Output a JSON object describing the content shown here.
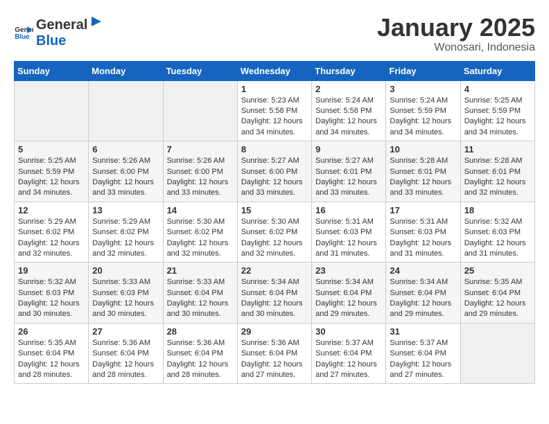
{
  "header": {
    "logo_general": "General",
    "logo_blue": "Blue",
    "month_title": "January 2025",
    "location": "Wonosari, Indonesia"
  },
  "weekdays": [
    "Sunday",
    "Monday",
    "Tuesday",
    "Wednesday",
    "Thursday",
    "Friday",
    "Saturday"
  ],
  "weeks": [
    [
      {
        "day": "",
        "empty": true
      },
      {
        "day": "",
        "empty": true
      },
      {
        "day": "",
        "empty": true
      },
      {
        "day": "1",
        "sunrise": "5:23 AM",
        "sunset": "5:58 PM",
        "daylight": "12 hours and 34 minutes."
      },
      {
        "day": "2",
        "sunrise": "5:24 AM",
        "sunset": "5:58 PM",
        "daylight": "12 hours and 34 minutes."
      },
      {
        "day": "3",
        "sunrise": "5:24 AM",
        "sunset": "5:59 PM",
        "daylight": "12 hours and 34 minutes."
      },
      {
        "day": "4",
        "sunrise": "5:25 AM",
        "sunset": "5:59 PM",
        "daylight": "12 hours and 34 minutes."
      }
    ],
    [
      {
        "day": "5",
        "sunrise": "5:25 AM",
        "sunset": "5:59 PM",
        "daylight": "12 hours and 34 minutes."
      },
      {
        "day": "6",
        "sunrise": "5:26 AM",
        "sunset": "6:00 PM",
        "daylight": "12 hours and 33 minutes."
      },
      {
        "day": "7",
        "sunrise": "5:26 AM",
        "sunset": "6:00 PM",
        "daylight": "12 hours and 33 minutes."
      },
      {
        "day": "8",
        "sunrise": "5:27 AM",
        "sunset": "6:00 PM",
        "daylight": "12 hours and 33 minutes."
      },
      {
        "day": "9",
        "sunrise": "5:27 AM",
        "sunset": "6:01 PM",
        "daylight": "12 hours and 33 minutes."
      },
      {
        "day": "10",
        "sunrise": "5:28 AM",
        "sunset": "6:01 PM",
        "daylight": "12 hours and 33 minutes."
      },
      {
        "day": "11",
        "sunrise": "5:28 AM",
        "sunset": "6:01 PM",
        "daylight": "12 hours and 32 minutes."
      }
    ],
    [
      {
        "day": "12",
        "sunrise": "5:29 AM",
        "sunset": "6:02 PM",
        "daylight": "12 hours and 32 minutes."
      },
      {
        "day": "13",
        "sunrise": "5:29 AM",
        "sunset": "6:02 PM",
        "daylight": "12 hours and 32 minutes."
      },
      {
        "day": "14",
        "sunrise": "5:30 AM",
        "sunset": "6:02 PM",
        "daylight": "12 hours and 32 minutes."
      },
      {
        "day": "15",
        "sunrise": "5:30 AM",
        "sunset": "6:02 PM",
        "daylight": "12 hours and 32 minutes."
      },
      {
        "day": "16",
        "sunrise": "5:31 AM",
        "sunset": "6:03 PM",
        "daylight": "12 hours and 31 minutes."
      },
      {
        "day": "17",
        "sunrise": "5:31 AM",
        "sunset": "6:03 PM",
        "daylight": "12 hours and 31 minutes."
      },
      {
        "day": "18",
        "sunrise": "5:32 AM",
        "sunset": "6:03 PM",
        "daylight": "12 hours and 31 minutes."
      }
    ],
    [
      {
        "day": "19",
        "sunrise": "5:32 AM",
        "sunset": "6:03 PM",
        "daylight": "12 hours and 30 minutes."
      },
      {
        "day": "20",
        "sunrise": "5:33 AM",
        "sunset": "6:03 PM",
        "daylight": "12 hours and 30 minutes."
      },
      {
        "day": "21",
        "sunrise": "5:33 AM",
        "sunset": "6:04 PM",
        "daylight": "12 hours and 30 minutes."
      },
      {
        "day": "22",
        "sunrise": "5:34 AM",
        "sunset": "6:04 PM",
        "daylight": "12 hours and 30 minutes."
      },
      {
        "day": "23",
        "sunrise": "5:34 AM",
        "sunset": "6:04 PM",
        "daylight": "12 hours and 29 minutes."
      },
      {
        "day": "24",
        "sunrise": "5:34 AM",
        "sunset": "6:04 PM",
        "daylight": "12 hours and 29 minutes."
      },
      {
        "day": "25",
        "sunrise": "5:35 AM",
        "sunset": "6:04 PM",
        "daylight": "12 hours and 29 minutes."
      }
    ],
    [
      {
        "day": "26",
        "sunrise": "5:35 AM",
        "sunset": "6:04 PM",
        "daylight": "12 hours and 28 minutes."
      },
      {
        "day": "27",
        "sunrise": "5:36 AM",
        "sunset": "6:04 PM",
        "daylight": "12 hours and 28 minutes."
      },
      {
        "day": "28",
        "sunrise": "5:36 AM",
        "sunset": "6:04 PM",
        "daylight": "12 hours and 28 minutes."
      },
      {
        "day": "29",
        "sunrise": "5:36 AM",
        "sunset": "6:04 PM",
        "daylight": "12 hours and 27 minutes."
      },
      {
        "day": "30",
        "sunrise": "5:37 AM",
        "sunset": "6:04 PM",
        "daylight": "12 hours and 27 minutes."
      },
      {
        "day": "31",
        "sunrise": "5:37 AM",
        "sunset": "6:04 PM",
        "daylight": "12 hours and 27 minutes."
      },
      {
        "day": "",
        "empty": true
      }
    ]
  ],
  "labels": {
    "sunrise": "Sunrise:",
    "sunset": "Sunset:",
    "daylight": "Daylight:"
  }
}
